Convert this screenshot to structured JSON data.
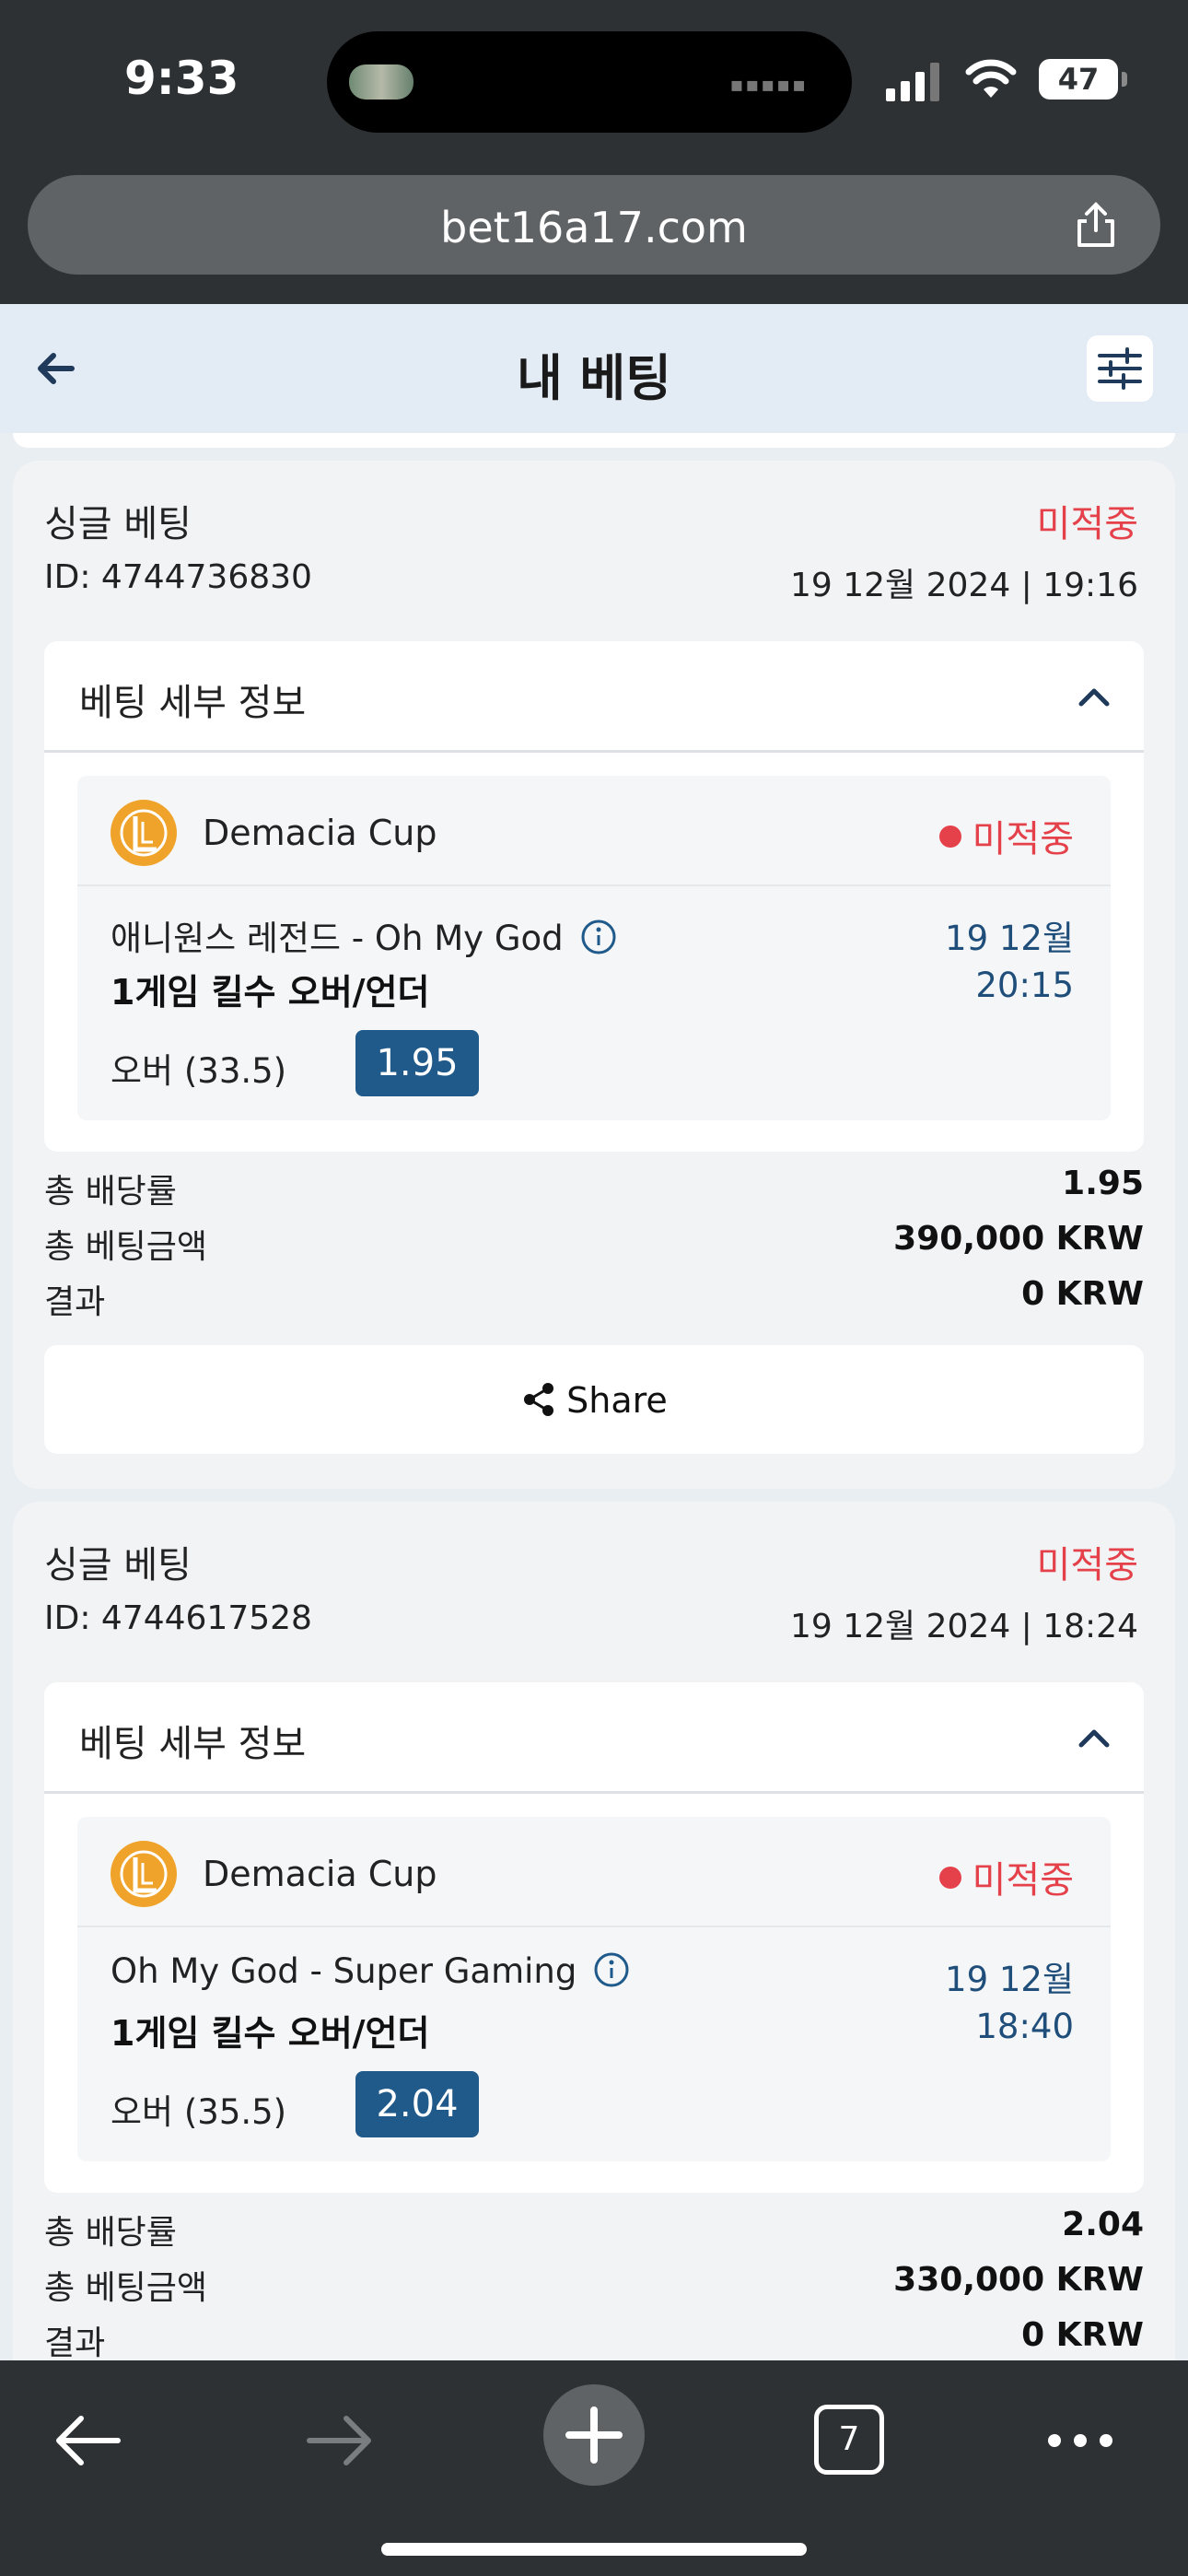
{
  "status_bar": {
    "time": "9:33",
    "battery": "47"
  },
  "browser": {
    "url": "bet16a17.com",
    "tab_count": "7"
  },
  "app": {
    "title": "내 베팅"
  },
  "bets": [
    {
      "type": "싱글 베팅",
      "status": "미적중",
      "id": "ID: 4744736830",
      "datetime": "19 12월 2024 | 19:16",
      "details_title": "베팅 세부 정보",
      "league": "Demacia Cup",
      "selection_status": "미적중",
      "teams": "애니원스 레전드 - Oh My God",
      "match_date": "19 12월",
      "match_time": "20:15",
      "market": "1게임 킬수 오버/언더",
      "pick": "오버 (33.5)",
      "odds": "1.95",
      "total_odds_label": "총 배당률",
      "total_odds": "1.95",
      "stake_label": "총 베팅금액",
      "stake": "390,000 KRW",
      "result_label": "결과",
      "result": "0 KRW",
      "share_label": "Share"
    },
    {
      "type": "싱글 베팅",
      "status": "미적중",
      "id": "ID: 4744617528",
      "datetime": "19 12월 2024 | 18:24",
      "details_title": "베팅 세부 정보",
      "league": "Demacia Cup",
      "selection_status": "미적중",
      "teams": "Oh My God - Super Gaming",
      "match_date": "19 12월",
      "match_time": "18:40",
      "market": "1게임 킬수 오버/언더",
      "pick": "오버 (35.5)",
      "odds": "2.04",
      "total_odds_label": "총 배당률",
      "total_odds": "2.04",
      "stake_label": "총 베팅금액",
      "stake": "330,000 KRW",
      "result_label": "결과",
      "result": "0 KRW"
    }
  ],
  "colors": {
    "lost_red": "#e5414a",
    "odds_blue": "#1f5a8b",
    "date_blue": "#1f4e7a",
    "browser_chrome": "#2e3133"
  },
  "icons": [
    "back-arrow-icon",
    "filter-icon",
    "chevron-up-icon",
    "league-of-legends-icon",
    "info-icon",
    "share-icon",
    "plus-icon",
    "more-icon"
  ]
}
